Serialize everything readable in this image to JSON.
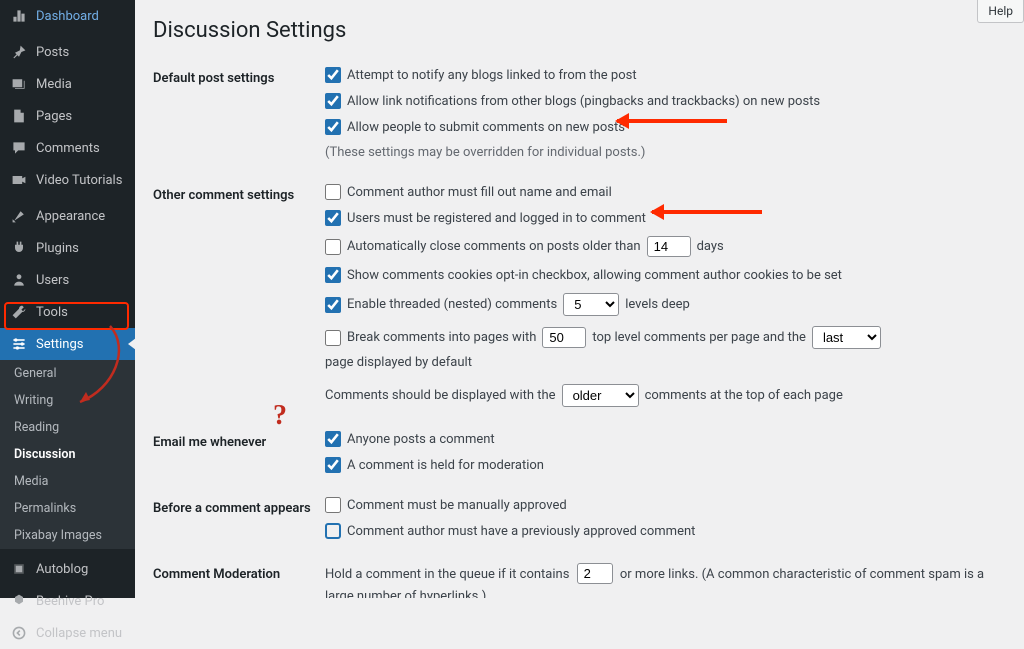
{
  "help_label": "Help",
  "page_title": "Discussion Settings",
  "sidebar": {
    "items": [
      {
        "icon": "dashboard",
        "label": "Dashboard"
      },
      {
        "icon": "pin",
        "label": "Posts"
      },
      {
        "icon": "media",
        "label": "Media"
      },
      {
        "icon": "page",
        "label": "Pages"
      },
      {
        "icon": "comments",
        "label": "Comments"
      },
      {
        "icon": "video",
        "label": "Video Tutorials"
      },
      {
        "icon": "appearance",
        "label": "Appearance"
      },
      {
        "icon": "plugins",
        "label": "Plugins"
      },
      {
        "icon": "users",
        "label": "Users"
      },
      {
        "icon": "tools",
        "label": "Tools"
      },
      {
        "icon": "settings",
        "label": "Settings"
      }
    ],
    "submenu": [
      "General",
      "Writing",
      "Reading",
      "Discussion",
      "Media",
      "Permalinks",
      "Pixabay Images"
    ],
    "after_items": [
      {
        "icon": "autoblog",
        "label": "Autoblog"
      },
      {
        "icon": "beehive",
        "label": "Beehive Pro"
      }
    ],
    "collapse_label": "Collapse menu"
  },
  "sections": {
    "default_post": {
      "heading": "Default post settings",
      "opt1": "Attempt to notify any blogs linked to from the post",
      "opt2": "Allow link notifications from other blogs (pingbacks and trackbacks) on new posts",
      "opt3": "Allow people to submit comments on new posts",
      "hint": "(These settings may be overridden for individual posts.)"
    },
    "other": {
      "heading": "Other comment settings",
      "opt1": "Comment author must fill out name and email",
      "opt2": "Users must be registered and logged in to comment",
      "opt3_pre": "Automatically close comments on posts older than",
      "opt3_val": "14",
      "opt3_post": "days",
      "opt4": "Show comments cookies opt-in checkbox, allowing comment author cookies to be set",
      "opt5_pre": "Enable threaded (nested) comments",
      "opt5_val": "5",
      "opt5_post": "levels deep",
      "opt6_pre": "Break comments into pages with",
      "opt6_val": "50",
      "opt6_mid": "top level comments per page and the",
      "opt6_sel": "last",
      "opt6_post": "page displayed by default",
      "opt7_pre": "Comments should be displayed with the",
      "opt7_sel": "older",
      "opt7_post": "comments at the top of each page"
    },
    "email": {
      "heading": "Email me whenever",
      "opt1": "Anyone posts a comment",
      "opt2": "A comment is held for moderation"
    },
    "before": {
      "heading": "Before a comment appears",
      "opt1": "Comment must be manually approved",
      "opt2": "Comment author must have a previously approved comment"
    },
    "moderation": {
      "heading": "Comment Moderation",
      "pre": "Hold a comment in the queue if it contains",
      "val": "2",
      "post": "or more links. (A common characteristic of comment spam is a large number of hyperlinks.)"
    }
  },
  "annotations": {
    "question_mark": "?"
  }
}
